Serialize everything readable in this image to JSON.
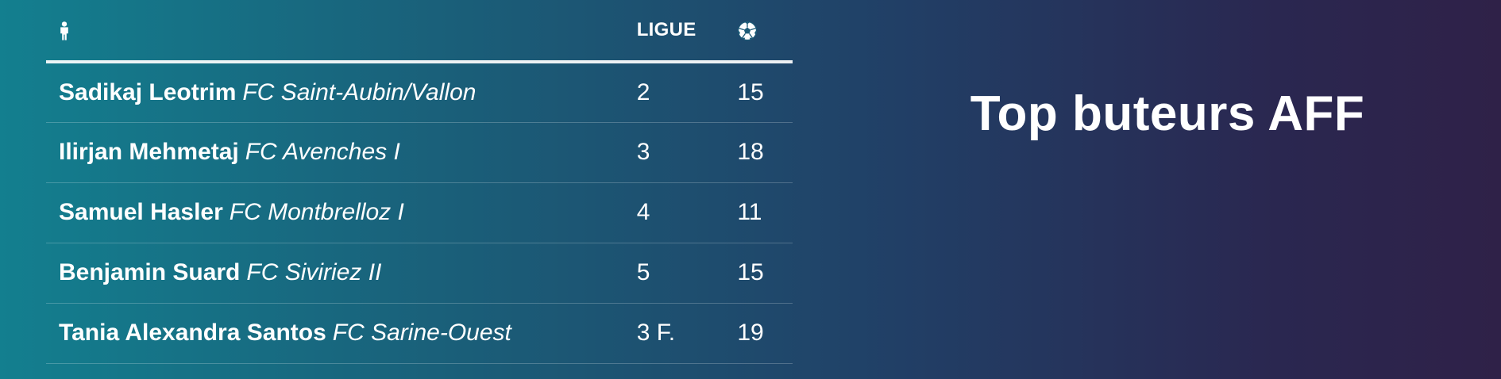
{
  "title": "Top buteurs AFF",
  "table": {
    "header": {
      "player_icon": "person-icon",
      "league_label": "LIGUE",
      "goals_icon": "soccer-ball-icon"
    },
    "rows": [
      {
        "name": "Sadikaj Leotrim",
        "club": "FC Saint-Aubin/Vallon",
        "league": "2",
        "goals": "15"
      },
      {
        "name": "Ilirjan Mehmetaj",
        "club": "FC Avenches I",
        "league": "3",
        "goals": "18"
      },
      {
        "name": "Samuel Hasler",
        "club": "FC Montbrelloz I",
        "league": "4",
        "goals": "11"
      },
      {
        "name": "Benjamin Suard",
        "club": "FC Siviriez II",
        "league": "5",
        "goals": "15"
      },
      {
        "name": "Tania Alexandra Santos",
        "club": "FC Sarine-Ouest",
        "league": "3 F.",
        "goals": "19"
      }
    ]
  },
  "colors": {
    "gradient_start": "#137f8f",
    "gradient_end": "#2f2148",
    "text": "#ffffff"
  }
}
